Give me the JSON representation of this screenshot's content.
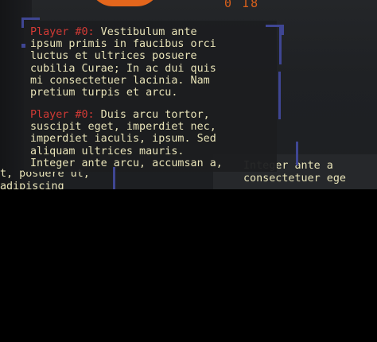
{
  "top_glyphs": "0 18",
  "chat": {
    "messages": [
      {
        "speaker": "Player #0:",
        "lines": [
          " Vestibulum ante",
          "ipsum primis in faucibus orci",
          "luctus et ultrices posuere",
          "cubilia Curae; In ac dui quis",
          "mi consectetuer lacinia. Nam",
          "pretium turpis et arcu."
        ]
      },
      {
        "speaker": "Player #0:",
        "lines": [
          " Duis arcu tortor,",
          "suscipit eget, imperdiet nec,",
          "imperdiet iaculis, ipsum. Sed",
          "aliquam ultrices mauris.",
          "Integer ante arcu, accumsan a,"
        ]
      }
    ],
    "back_left": [
      "t, posuere ut,",
      "adipiscing"
    ],
    "back_right": [
      "Integer ante a",
      "consectetuer ege"
    ]
  }
}
